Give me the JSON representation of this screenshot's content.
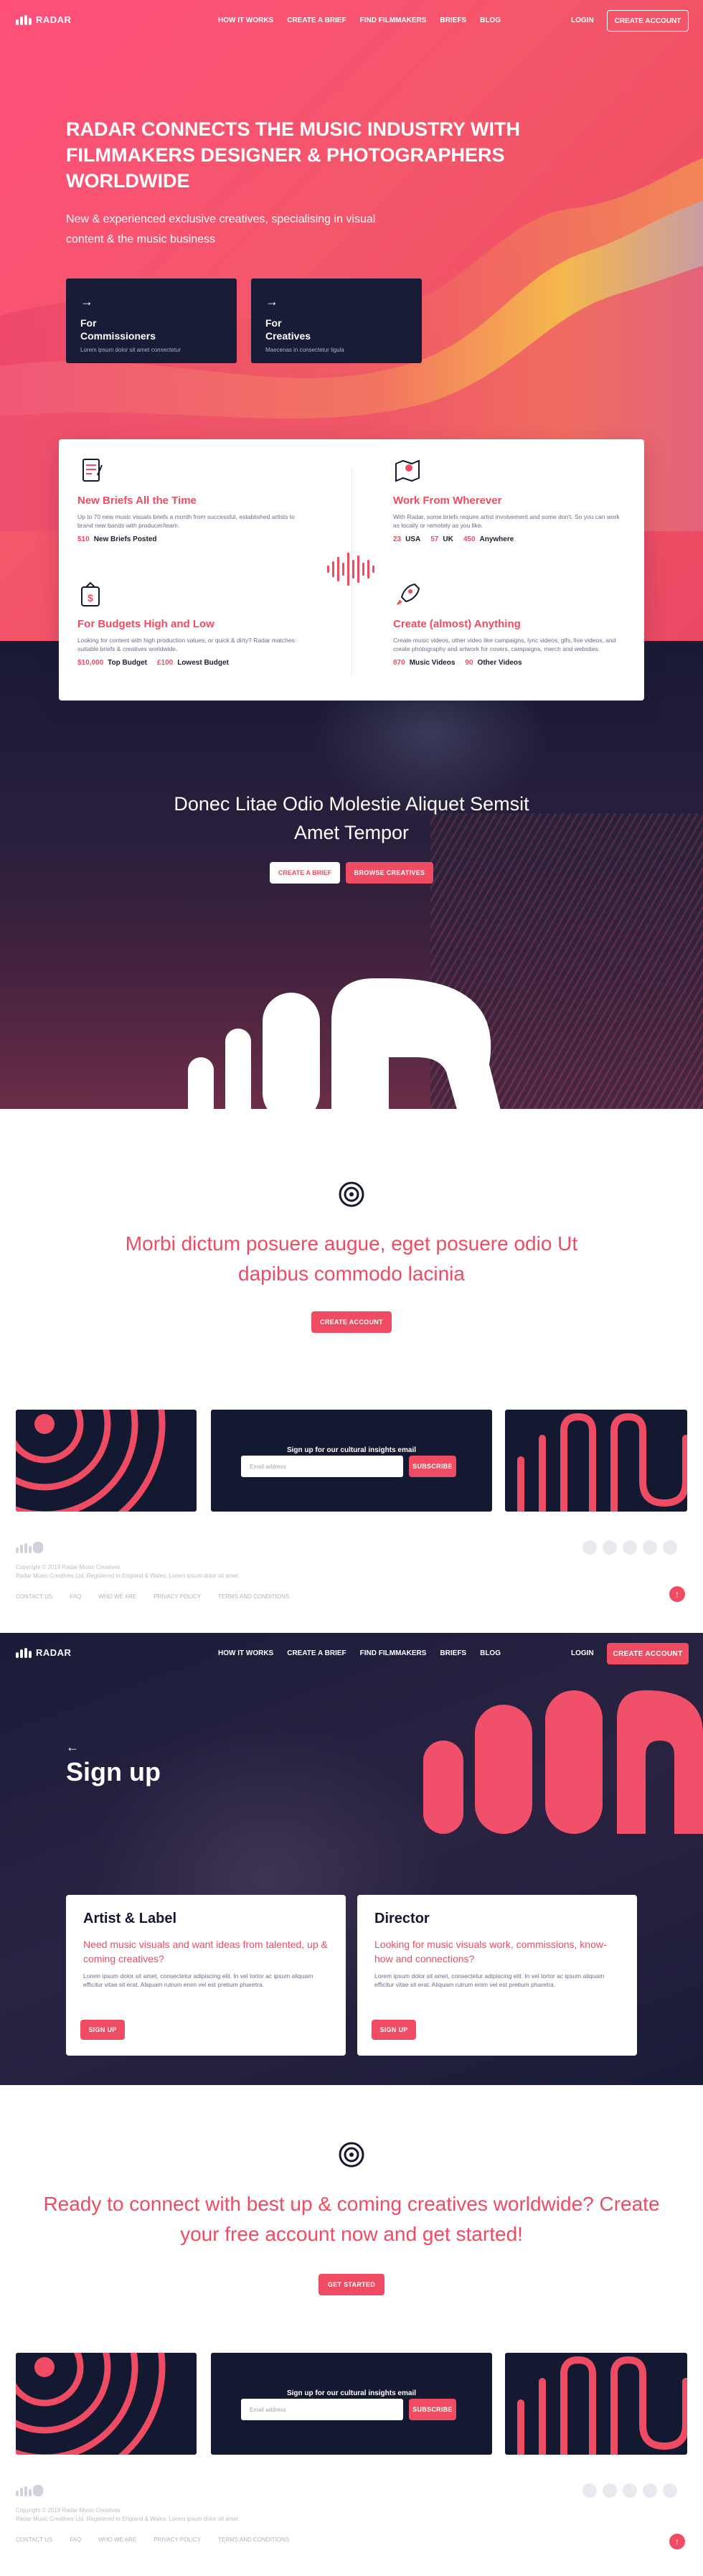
{
  "brand": {
    "name": "RADAR",
    "accent": "#ef4b62",
    "navy": "#141932"
  },
  "nav": {
    "links": [
      "HOW IT WORKS",
      "CREATE A BRIEF",
      "FIND FILMMAKERS",
      "BRIEFS",
      "BLOG"
    ],
    "login": "LOGIN",
    "cta": "CREATE ACCOUNT"
  },
  "hero": {
    "title": "RADAR CONNECTS THE MUSIC INDUSTRY WITH FILMMAKERS DESIGNER & PHOTOGRAPHERS WORLDWIDE",
    "subtitle": "New & experienced exclusive creatives, specialising in visual content & the music business",
    "cards": [
      {
        "line1": "For",
        "line2": "Commissioners",
        "desc": "Lorem ipsum dolor sit amet consectetur"
      },
      {
        "line1": "For",
        "line2": "Creatives",
        "desc": "Maecenas in consectetur ligula"
      }
    ]
  },
  "features": [
    {
      "icon": "brief-document-icon",
      "title": "New Briefs All the Time",
      "desc": "Up to 70 new music visuals briefs a month from successful, established artists to brand new bands with producer/team.",
      "stats": [
        {
          "value": "$10",
          "label": "New Briefs Posted"
        }
      ]
    },
    {
      "icon": "map-pin-icon",
      "title": "Work From Wherever",
      "desc": "With Radar, some briefs require artist involvement and some don't. So you can work as locally or remotely as you like.",
      "stats": [
        {
          "value": "23",
          "label": "USA"
        },
        {
          "value": "57",
          "label": "UK"
        },
        {
          "value": "450",
          "label": "Anywhere"
        }
      ]
    },
    {
      "icon": "money-bag-icon",
      "title": "For Budgets High and Low",
      "desc": "Looking for content with high production values, or quick & dirty? Radar matches suitable briefs & creatives worldwide.",
      "stats": [
        {
          "value": "$10,000",
          "label": "Top Budget"
        },
        {
          "value": "£100",
          "label": "Lowest Budget"
        }
      ]
    },
    {
      "icon": "rocket-icon",
      "title": "Create (almost) Anything",
      "desc": "Create music videos, other video like campaigns, lyric videos, gifs, live videos, and create photography and artwork for covers, campaigns, merch and websites.",
      "stats": [
        {
          "value": "870",
          "label": "Music Videos"
        },
        {
          "value": "90",
          "label": "Other Videos"
        }
      ]
    }
  ],
  "studio": {
    "headline": "Donec Litae Odio Molestie Aliquet Semsit Amet Tempor",
    "btn_brief": "CREATE A BRIEF",
    "btn_browse": "BROWSE CREATIVES"
  },
  "promo": {
    "text": "Morbi dictum posuere augue, eget posuere odio Ut dapibus commodo lacinia",
    "cta": "CREATE ACCOUNT"
  },
  "newsletter": {
    "title": "Sign up for our cultural insights email",
    "placeholder": "Email address",
    "button": "SUBSCRIBE"
  },
  "footer": {
    "copyright": "Copyright © 2019 Radar Music Creatives",
    "address": "Radar Music Creatives Ltd. Registered in England & Wales. Lorem ipsum dolor sit amet",
    "links": [
      "CONTACT US",
      "FAQ",
      "WHO WE ARE",
      "PRIVACY POLICY",
      "TERMS AND CONDITIONS"
    ],
    "totop": "↑"
  },
  "signup": {
    "back": "←",
    "title": "Sign up",
    "cards": [
      {
        "title": "Artist & Label",
        "lead": "Need music visuals and want ideas from talented, up & coming creatives?",
        "desc": "Lorem ipsum dolor sit amet, consectetur adipiscing elit. In vel tortor ac ipsum aliquam efficitur vitae sit erat. Aliquam rutrum enim vel est pretium pharetra.",
        "button": "SIGN UP"
      },
      {
        "title": "Director",
        "lead": "Looking for music visuals work, commissions, know-how and connections?",
        "desc": "Lorem ipsum dolor sit amet, consectetur adipiscing elit. In vel tortor ac ipsum aliquam efficitur vitae sit erat. Aliquam rutrum enim vel est pretium pharetra.",
        "button": "SIGN UP"
      }
    ]
  },
  "ready": {
    "text": "Ready to connect with best up & coming creatives worldwide? Create your free account now and get started!",
    "cta": "GET STARTED"
  }
}
